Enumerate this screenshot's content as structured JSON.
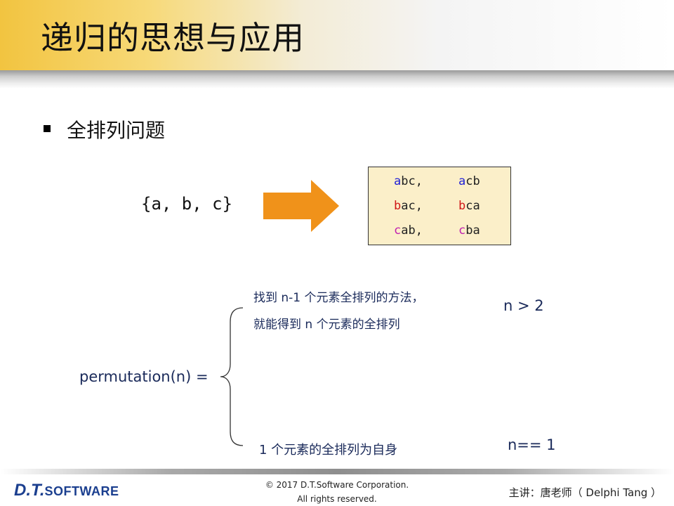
{
  "title": "递归的思想与应用",
  "bullet": "全排列问题",
  "input_set": "{a, b, c}",
  "permutations": [
    {
      "first": "a",
      "rest": "bc,"
    },
    {
      "first": "a",
      "rest": "cb"
    },
    {
      "first": "b",
      "rest": "ac,"
    },
    {
      "first": "b",
      "rest": "ca"
    },
    {
      "first": "c",
      "rest": "ab,"
    },
    {
      "first": "c",
      "rest": "ba"
    }
  ],
  "colors": {
    "a": "#1f1fd6",
    "b": "#d01818",
    "c": "#c01fb0",
    "arrow": "#f0921a",
    "box_fill": "#fbefc9"
  },
  "formula": {
    "lhs": "permutation(n) =",
    "case1_line1": "找到 n-1 个元素全排列的方法，",
    "case1_line2": "就能得到 n 个元素的全排列",
    "case1_cond": "n > 2",
    "case2_text": "1 个元素的全排列为自身",
    "case2_cond": "n== 1"
  },
  "footer": {
    "logo_dt": "D.T.",
    "logo_software": "SOFTWARE",
    "copyright_line1": "© 2017 D.T.Software Corporation.",
    "copyright_line2": "All rights reserved.",
    "presenter": "主讲：唐老师（ Delphi Tang ）"
  }
}
